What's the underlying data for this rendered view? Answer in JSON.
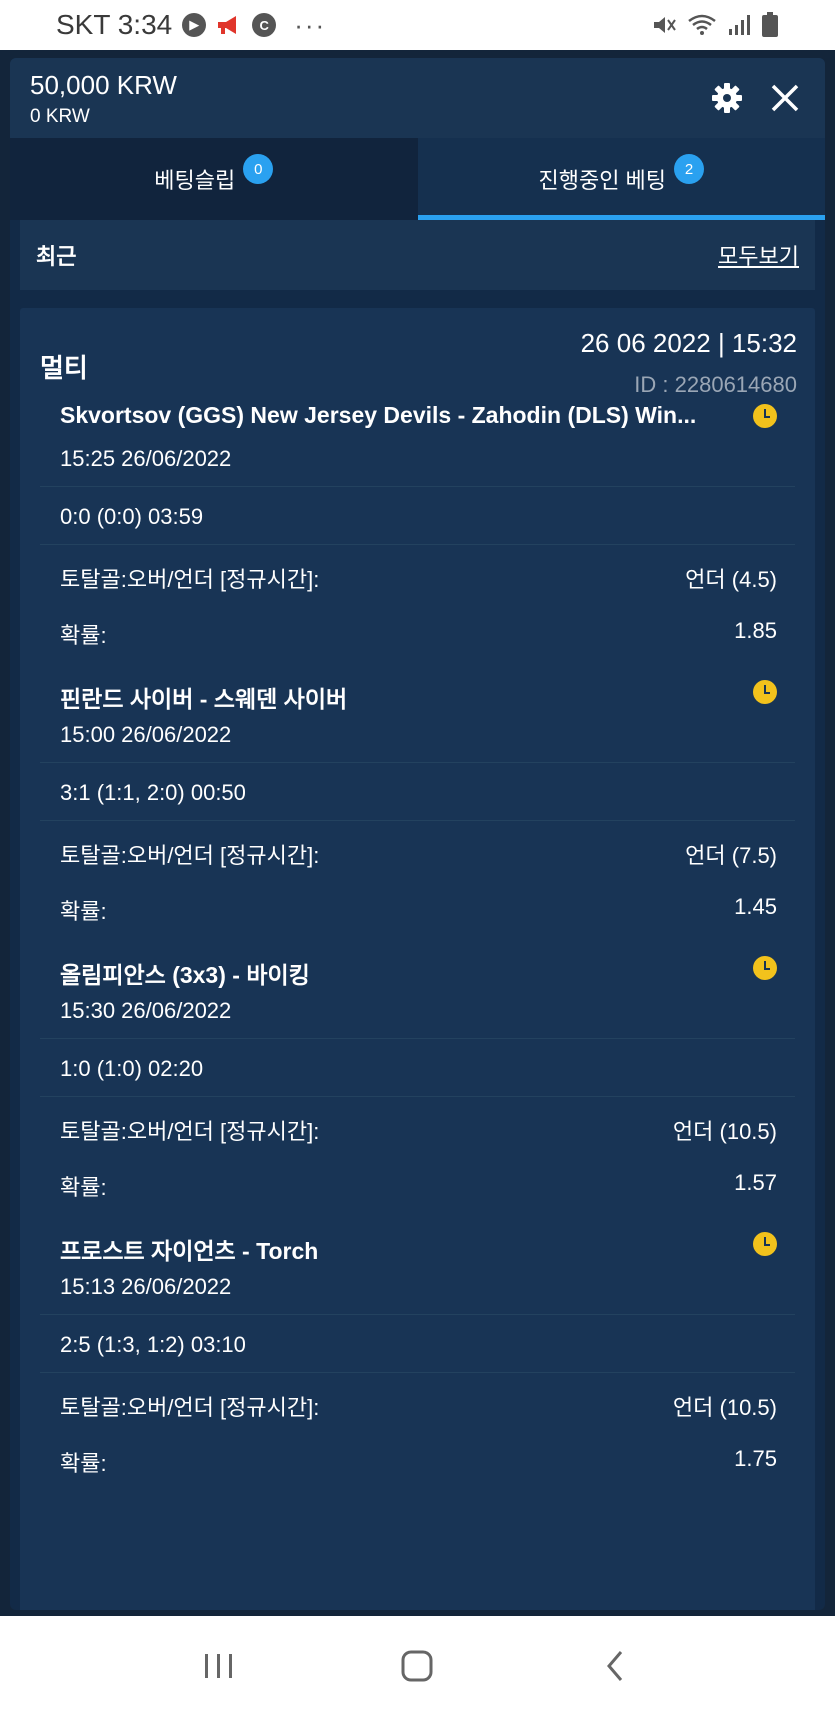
{
  "status_bar": {
    "carrier_time": "SKT 3:34",
    "dots": "···"
  },
  "header": {
    "balance": "50,000 KRW",
    "sub_balance": "0 KRW"
  },
  "tabs": [
    {
      "label": "베팅슬립",
      "count": "0"
    },
    {
      "label": "진행중인 베팅",
      "count": "2"
    }
  ],
  "recent": {
    "label": "최근",
    "view_all": "모두보기"
  },
  "bet": {
    "type": "멀티",
    "datetime": "26 06 2022 | 15:32",
    "id_label": "ID :",
    "id_value": "2280614680",
    "id_full": "ID :  2280614680",
    "selections": [
      {
        "match": "Skvortsov (GGS) New Jersey Devils - Zahodin (DLS) Win...",
        "time": "15:25   26/06/2022",
        "score": "0:0 (0:0) 03:59",
        "market": "토탈골:오버/언더 [정규시간]:",
        "pick": "언더 (4.5)",
        "odds_label": "확률:",
        "odds": "1.85"
      },
      {
        "match": "핀란드 사이버 - 스웨덴 사이버",
        "time": "15:00   26/06/2022",
        "score": "3:1 (1:1, 2:0) 00:50",
        "market": "토탈골:오버/언더 [정규시간]:",
        "pick": "언더 (7.5)",
        "odds_label": "확률:",
        "odds": "1.45"
      },
      {
        "match": "올림피안스 (3x3) - 바이킹",
        "time": "15:30   26/06/2022",
        "score": "1:0 (1:0) 02:20",
        "market": "토탈골:오버/언더 [정규시간]:",
        "pick": "언더 (10.5)",
        "odds_label": "확률:",
        "odds": "1.57"
      },
      {
        "match": "프로스트 자이언츠 - Torch",
        "time": "15:13   26/06/2022",
        "score": "2:5 (1:3, 1:2) 03:10",
        "market": "토탈골:오버/언더 [정규시간]:",
        "pick": "언더 (10.5)",
        "odds_label": "확률:",
        "odds": "1.75"
      }
    ]
  },
  "colors": {
    "accent": "#2aa1f0",
    "panel": "#122a47",
    "card": "#183455",
    "clock": "#f2c21c"
  }
}
